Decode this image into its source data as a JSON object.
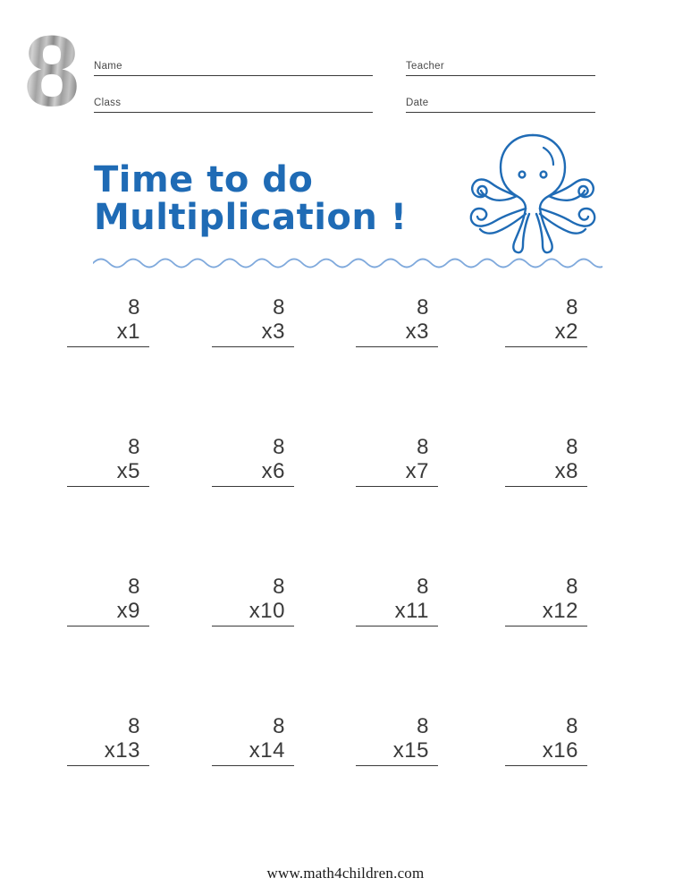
{
  "worksheet": {
    "logo_number": "8",
    "accent_color": "#1F6BB5",
    "wave_color": "#7FA9DC",
    "text_color": "#3A3A3A",
    "title_line_1": "Time to do",
    "title_line_2": "Multiplication !",
    "footer": "www.math4children.com",
    "octopus_icon": "octopus-icon",
    "wave_divider_icon": "wave-divider-icon"
  },
  "header": {
    "fields": [
      {
        "label": "Name",
        "value": "",
        "placeholder": ""
      },
      {
        "label": "Class",
        "value": "",
        "placeholder": ""
      },
      {
        "label": "Teacher",
        "value": "",
        "placeholder": ""
      },
      {
        "label": "Date",
        "value": "",
        "placeholder": ""
      }
    ]
  },
  "problems": {
    "operand": "8",
    "rows": [
      [
        {
          "top": "8",
          "bottom": "x1",
          "answer": ""
        },
        {
          "top": "8",
          "bottom": "x3",
          "answer": ""
        },
        {
          "top": "8",
          "bottom": "x3",
          "answer": ""
        },
        {
          "top": "8",
          "bottom": "x2",
          "answer": ""
        }
      ],
      [
        {
          "top": "8",
          "bottom": "x5",
          "answer": ""
        },
        {
          "top": "8",
          "bottom": "x6",
          "answer": ""
        },
        {
          "top": "8",
          "bottom": "x7",
          "answer": ""
        },
        {
          "top": "8",
          "bottom": "x8",
          "answer": ""
        }
      ],
      [
        {
          "top": "8",
          "bottom": "x9",
          "answer": ""
        },
        {
          "top": "8",
          "bottom": "x10",
          "answer": ""
        },
        {
          "top": "8",
          "bottom": "x11",
          "answer": ""
        },
        {
          "top": "8",
          "bottom": "x12",
          "answer": ""
        }
      ],
      [
        {
          "top": "8",
          "bottom": "x13",
          "answer": ""
        },
        {
          "top": "8",
          "bottom": "x14",
          "answer": ""
        },
        {
          "top": "8",
          "bottom": "x15",
          "answer": ""
        },
        {
          "top": "8",
          "bottom": "x16",
          "answer": ""
        }
      ]
    ]
  }
}
